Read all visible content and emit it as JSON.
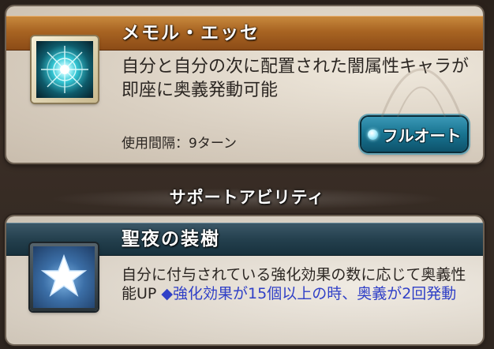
{
  "ability": {
    "name": "メモル・エッセ",
    "description": "自分と自分の次に配置された闇属性キャラが即座に奥義発動可能",
    "cooldown": "使用間隔：9ターン",
    "button_label": "フルオート",
    "icon": "radiant-crystal-icon"
  },
  "support_heading": "サポートアビリティ",
  "support": {
    "name": "聖夜の装樹",
    "description_main": "自分に付与されている強化効果の数に応じて奥義性能UP",
    "description_note": "◆強化効果が15個以上の時、奥義が2回発動",
    "icon": "star-icon"
  },
  "colors": {
    "ability_header": "#a86422",
    "support_header": "#24404e",
    "note_text": "#2f3fc7",
    "button": "#187390"
  }
}
